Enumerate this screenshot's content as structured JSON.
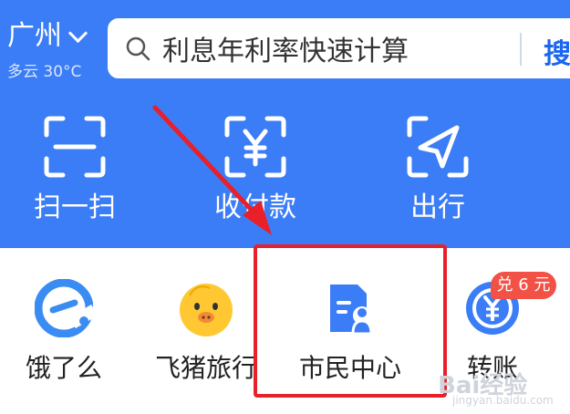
{
  "header": {
    "city": "广州",
    "weather": "多云 30°C",
    "search_placeholder": "利息年利率快速计算",
    "search_button": "搜"
  },
  "quick_actions": [
    {
      "label": "扫一扫",
      "icon": "scan-icon"
    },
    {
      "label": "收付款",
      "icon": "yuan-payment-icon"
    },
    {
      "label": "出行",
      "icon": "navigation-arrow-icon"
    }
  ],
  "apps": [
    {
      "label": "饿了么",
      "icon": "eleme-logo-icon"
    },
    {
      "label": "飞猪旅行",
      "icon": "fliggy-logo-icon"
    },
    {
      "label": "市民中心",
      "icon": "citizen-center-icon"
    },
    {
      "label": "转账",
      "icon": "transfer-yuan-icon",
      "badge": "兑 6 元"
    }
  ],
  "colors": {
    "brand_blue": "#3b7df6",
    "highlight_red": "#e8202a",
    "badge_red": "#f25245"
  },
  "watermark": {
    "text": "Bai经验",
    "url_text": "jingyan.baidu.com"
  }
}
